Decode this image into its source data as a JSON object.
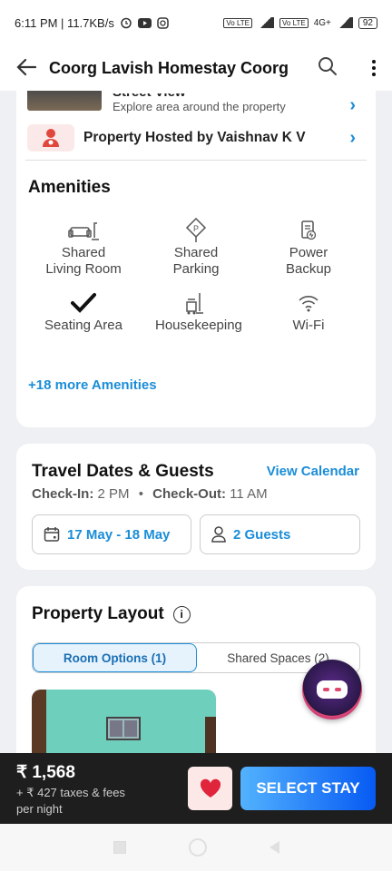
{
  "status_bar": {
    "time_speed": "6:11 PM | 11.7KB/s",
    "volte_1": "Vo LTE",
    "volte_2": "Vo LTE",
    "network": "4G+",
    "battery": "92"
  },
  "header": {
    "title": "Coorg Lavish Homestay Coorg"
  },
  "street_view": {
    "title": "Street View",
    "subtitle": "Explore area around the property"
  },
  "host": {
    "label": "Property Hosted by Vaishnav K V"
  },
  "amenities": {
    "title": "Amenities",
    "items": [
      {
        "label": "Shared Living Room",
        "icon": "sofa-icon"
      },
      {
        "label": "Shared Parking",
        "icon": "parking-icon"
      },
      {
        "label": "Power Backup",
        "icon": "power-backup-icon"
      },
      {
        "label": "Seating Area",
        "icon": "checkmark-icon"
      },
      {
        "label": "Housekeeping",
        "icon": "housekeeping-icon"
      },
      {
        "label": "Wi-Fi",
        "icon": "wifi-icon"
      }
    ],
    "more_label": "+18 more Amenities"
  },
  "travel": {
    "title": "Travel Dates & Guests",
    "view_calendar": "View Calendar",
    "checkin_label": "Check-In:",
    "checkin_time": "2 PM",
    "checkout_label": "Check-Out:",
    "checkout_time": "11 AM",
    "dates": "17 May - 18 May",
    "guests": "2 Guests"
  },
  "layout": {
    "title": "Property Layout",
    "tabs": [
      {
        "label": "Room Options (1)",
        "active": true
      },
      {
        "label": "Shared Spaces (2)",
        "active": false
      }
    ]
  },
  "bottom": {
    "price": "₹ 1,568",
    "taxes": "+ ₹ 427 taxes & fees",
    "per_night": "per night",
    "select_label": "SELECT STAY"
  },
  "colors": {
    "accent": "#1a8dd8",
    "button_start": "#53b2fe",
    "button_end": "#065af3",
    "heart": "#e0243c"
  }
}
